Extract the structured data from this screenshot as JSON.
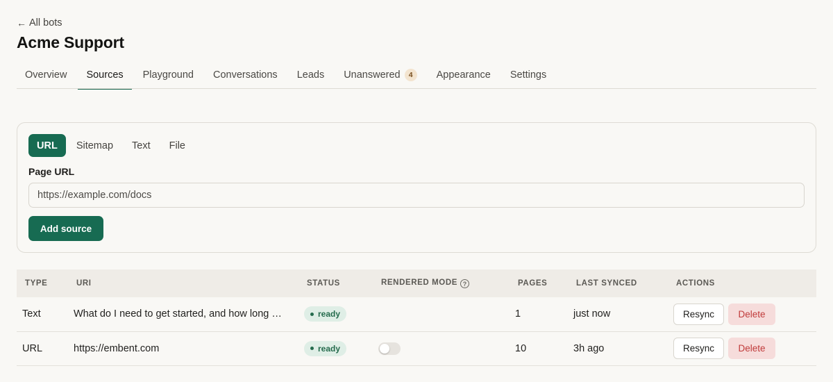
{
  "header": {
    "back_arrow": "←",
    "back_label": "All bots",
    "title": "Acme Support"
  },
  "tabs": [
    {
      "label": "Overview"
    },
    {
      "label": "Sources",
      "active": true
    },
    {
      "label": "Playground"
    },
    {
      "label": "Conversations"
    },
    {
      "label": "Leads"
    },
    {
      "label": "Unanswered",
      "badge": "4"
    },
    {
      "label": "Appearance"
    },
    {
      "label": "Settings"
    }
  ],
  "add_source": {
    "source_types": [
      "URL",
      "Sitemap",
      "Text",
      "File"
    ],
    "active_type": "URL",
    "field_label": "Page URL",
    "placeholder": "https://example.com/docs",
    "submit_label": "Add source"
  },
  "sources_table": {
    "columns": [
      "TYPE",
      "URI",
      "STATUS",
      "RENDERED MODE",
      "PAGES",
      "LAST SYNCED",
      "ACTIONS"
    ],
    "help_icon": "?",
    "rows": [
      {
        "type": "Text",
        "uri": "What do I need to get started, and how long …",
        "status": "ready",
        "rendered_mode": null,
        "pages": "1",
        "last_synced": "just now",
        "resync": "Resync",
        "delete": "Delete"
      },
      {
        "type": "URL",
        "uri": "https://embent.com",
        "status": "ready",
        "rendered_mode": false,
        "pages": "10",
        "last_synced": "3h ago",
        "resync": "Resync",
        "delete": "Delete"
      }
    ]
  },
  "colors": {
    "accent": "#176b52",
    "background": "#f9f8f5",
    "status_ready_bg": "#dfeee6",
    "status_ready_text": "#256b4d",
    "delete_bg": "#f6dcdb",
    "delete_text": "#c03a3a",
    "badge_bg": "#f3e4cf"
  }
}
